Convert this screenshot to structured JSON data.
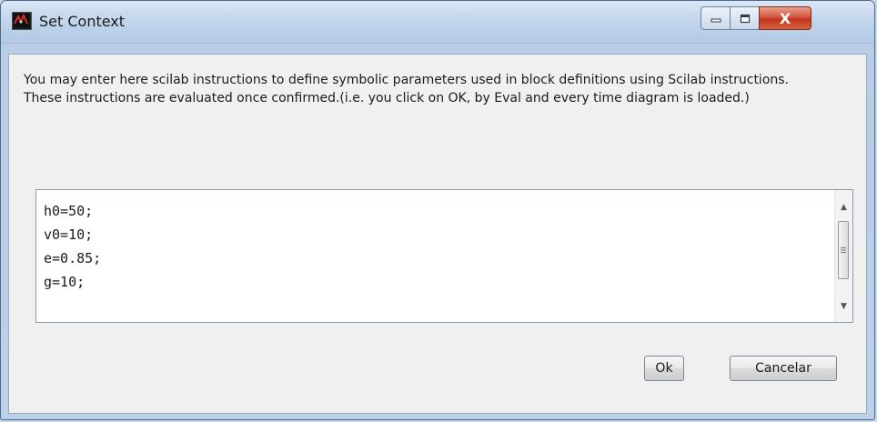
{
  "window": {
    "title": "Set Context",
    "close_glyph": "X"
  },
  "description": {
    "line1": "You may enter here scilab instructions to define symbolic parameters used in block definitions using Scilab instructions.",
    "line2": "These instructions are evaluated once confirmed.(i.e. you click on OK, by Eval and every time diagram is loaded.)"
  },
  "editor": {
    "lines": [
      "h0=50;",
      "v0=10;",
      "e=0.85;",
      "g=10;"
    ]
  },
  "buttons": {
    "ok_label": "Ok",
    "cancel_label": "Cancelar"
  },
  "icons": {
    "app": "scilab-app-icon",
    "minimize": "minimize-icon",
    "maximize": "maximize-icon",
    "close": "close-icon",
    "scroll_up": "scroll-up-arrow-icon",
    "scroll_down": "scroll-down-arrow-icon"
  },
  "colors": {
    "title_bar": "#c2d5ec",
    "close_button": "#c2351c",
    "content_background": "#f0f0f0"
  }
}
